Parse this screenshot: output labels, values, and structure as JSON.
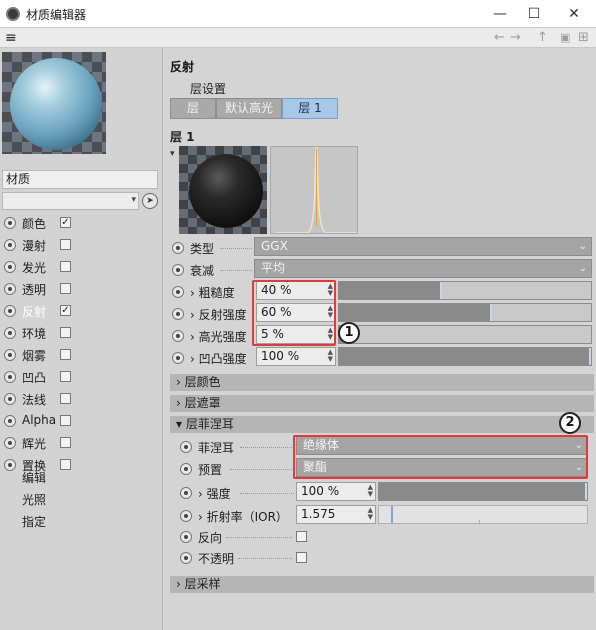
{
  "window": {
    "title": "材质编辑器",
    "minimize_glyph": "—",
    "maximize_glyph": "☐",
    "close_glyph": "✕"
  },
  "toolbar": {
    "menu_icon": "hamburger-icon",
    "back_glyph": "←",
    "forward_glyph": "→",
    "up_glyph": "↑",
    "lock_glyph": "🔒",
    "expand_glyph": "⊞"
  },
  "left": {
    "material_name": "材质",
    "channels": [
      {
        "label": "颜色",
        "checked": true,
        "check_glyph": "✓"
      },
      {
        "label": "漫射",
        "checked": false,
        "check_glyph": ""
      },
      {
        "label": "发光",
        "checked": false,
        "check_glyph": ""
      },
      {
        "label": "透明",
        "checked": false,
        "check_glyph": ""
      },
      {
        "label": "反射",
        "checked": true,
        "check_glyph": "✓",
        "selected": true
      },
      {
        "label": "环境",
        "checked": false,
        "check_glyph": ""
      },
      {
        "label": "烟雾",
        "checked": false,
        "check_glyph": ""
      },
      {
        "label": "凹凸",
        "checked": false,
        "check_glyph": ""
      },
      {
        "label": "法线",
        "checked": false,
        "check_glyph": ""
      },
      {
        "label": "Alpha",
        "checked": false,
        "check_glyph": ""
      },
      {
        "label": "辉光",
        "checked": false,
        "check_glyph": ""
      },
      {
        "label": "置换",
        "checked": false,
        "check_glyph": ""
      }
    ],
    "extra_items": [
      "编辑",
      "光照",
      "指定"
    ]
  },
  "right": {
    "section_title": "反射",
    "layer_settings_label": "层设置",
    "tabs": [
      {
        "label": "层",
        "active": false
      },
      {
        "label": "默认高光",
        "active": false
      },
      {
        "label": "层 1",
        "active": true
      }
    ],
    "layer_title": "层 1",
    "type": {
      "label": "类型",
      "value": "GGX"
    },
    "attenuation": {
      "label": "衰减",
      "value": "平均"
    },
    "roughness": {
      "label": "› 粗糙度",
      "value": "40 %",
      "level": 0.4
    },
    "refl_strength": {
      "label": "› 反射强度",
      "value": "60 %",
      "level": 0.6
    },
    "spec_strength": {
      "label": "› 高光强度",
      "value": "5 %",
      "level": 0.05
    },
    "bump_strength": {
      "label": "› 凹凸强度",
      "value": "100 %",
      "level": 1.0
    },
    "groups": {
      "layer_color": "› 层颜色",
      "layer_mask": "› 层遮罩",
      "layer_fresnel": "▾ 层菲涅耳",
      "layer_sampling": "› 层采样"
    },
    "fresnel": {
      "label": "菲涅耳",
      "value": "绝缘体"
    },
    "preset": {
      "label": "预置",
      "value": "聚酯"
    },
    "strength": {
      "label": "› 强度",
      "value": "100 %",
      "level": 1.0
    },
    "ior": {
      "label": "› 折射率（IOR）",
      "value": "1.575"
    },
    "invert": {
      "label": "反向"
    },
    "opaque": {
      "label": "不透明"
    },
    "callouts": [
      "1",
      "2"
    ]
  },
  "colors": {
    "selection_blue": "#a8c8e8",
    "highlight_red": "#e03a3a"
  }
}
